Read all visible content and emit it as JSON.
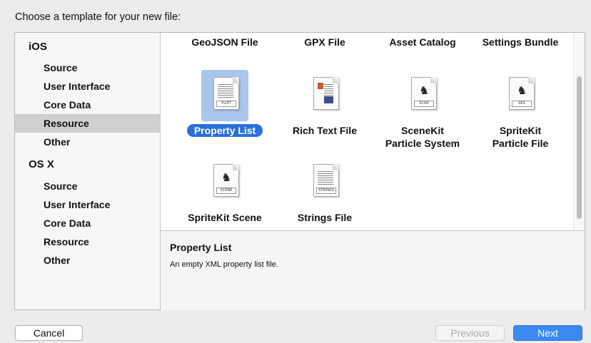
{
  "dialog": {
    "heading": "Choose a template for your new file:"
  },
  "sidebar": {
    "groups": [
      {
        "title": "iOS",
        "items": [
          "Source",
          "User Interface",
          "Core Data",
          "Resource",
          "Other"
        ],
        "selected": "Resource"
      },
      {
        "title": "OS X",
        "items": [
          "Source",
          "User Interface",
          "Core Data",
          "Resource",
          "Other"
        ]
      }
    ]
  },
  "templates": {
    "top_row": [
      "GeoJSON File",
      "GPX File",
      "Asset Catalog",
      "Settings Bundle"
    ],
    "tiles": [
      {
        "label": "Property List",
        "badge": "PLIST",
        "icon": "plist-file-icon",
        "selected": true
      },
      {
        "label": "Rich Text File",
        "badge": "",
        "icon": "rich-text-file-icon"
      },
      {
        "label": "SceneKit",
        "label2": "Particle System",
        "badge": "SCNP",
        "icon": "scenekit-particle-icon"
      },
      {
        "label": "SpriteKit",
        "label2": "Particle File",
        "badge": "SKS",
        "icon": "spritekit-particle-icon"
      },
      {
        "label": "SpriteKit Scene",
        "badge": "SCENE",
        "icon": "spritekit-scene-icon"
      },
      {
        "label": "Strings File",
        "badge": "STRINGS",
        "icon": "strings-file-icon"
      }
    ]
  },
  "description": {
    "title": "Property List",
    "text": "An empty XML property list file."
  },
  "buttons": {
    "cancel": "Cancel",
    "previous": "Previous",
    "next": "Next"
  },
  "colors": {
    "accent": "#2a6fdc",
    "next_button": "#3a8af2",
    "selection_row": "#d0d0d0",
    "icon_highlight": "#a9c6ec"
  }
}
